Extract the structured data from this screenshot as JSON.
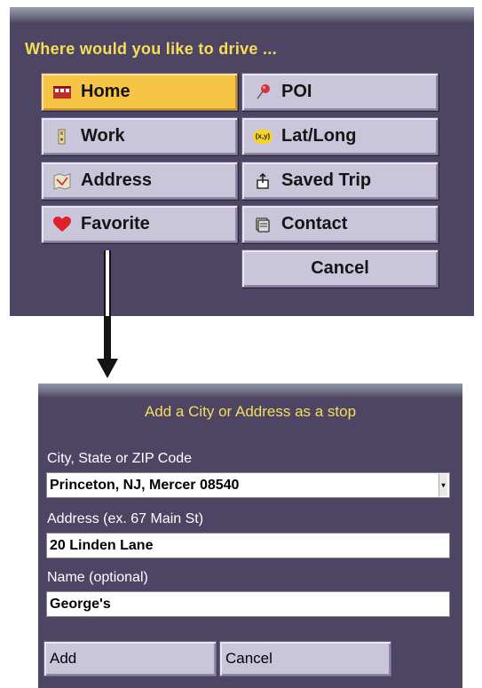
{
  "drive_menu": {
    "title": "Where would you like to drive ...",
    "buttons": [
      {
        "label": "Home",
        "icon": "home-icon"
      },
      {
        "label": "POI",
        "icon": "pushpin-icon"
      },
      {
        "label": "Work",
        "icon": "work-icon"
      },
      {
        "label": "Lat/Long",
        "icon": "xy-coordinates-icon",
        "icon_text": "(x,y)"
      },
      {
        "label": "Address",
        "icon": "map-icon"
      },
      {
        "label": "Saved Trip",
        "icon": "saved-trip-icon"
      },
      {
        "label": "Favorite",
        "icon": "heart-icon"
      },
      {
        "label": "Contact",
        "icon": "contact-card-icon"
      },
      {
        "label": "Cancel"
      }
    ],
    "selected": "Home",
    "colors": {
      "panel_bg": "#4e4564",
      "title": "#f4df57",
      "button_bg": "#c9c6dc",
      "selected_bg": "#f6c546"
    }
  },
  "stop_dialog": {
    "title": "Add a City or Address as a stop",
    "city": {
      "label": "City, State or ZIP Code",
      "value": "Princeton, NJ, Mercer 08540"
    },
    "address": {
      "label": "Address (ex. 67 Main St)",
      "value": "20 Linden Lane"
    },
    "name": {
      "label": "Name (optional)",
      "value": "George's"
    },
    "add_label": "Add",
    "cancel_label": "Cancel"
  }
}
